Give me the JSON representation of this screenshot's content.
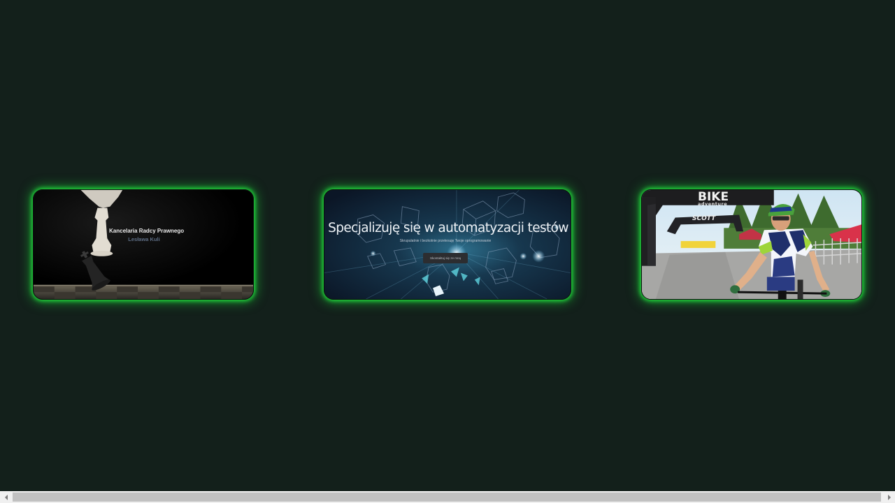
{
  "projects": [
    {
      "id": "law",
      "title": "Kancelaria Radcy Prawnego",
      "subtitle": "Lesława Kuli"
    },
    {
      "id": "test",
      "title": "Specjalizuję się w automatyzacji testów",
      "subtitle": "Skrupulatnie i bezkotnie przetesuję Twoje oprogramowanie",
      "button_label": "Skontaktuj się ze mną"
    },
    {
      "id": "bike",
      "arch_label": "BIKE",
      "arch_sub": "adventure",
      "arch2_label": "SCOTT"
    }
  ],
  "colors": {
    "page_background": "#13201b",
    "card_glow": "#1fd43a"
  },
  "icons": {
    "scroll_left": "triangle-left-icon",
    "scroll_right": "triangle-right-icon"
  }
}
